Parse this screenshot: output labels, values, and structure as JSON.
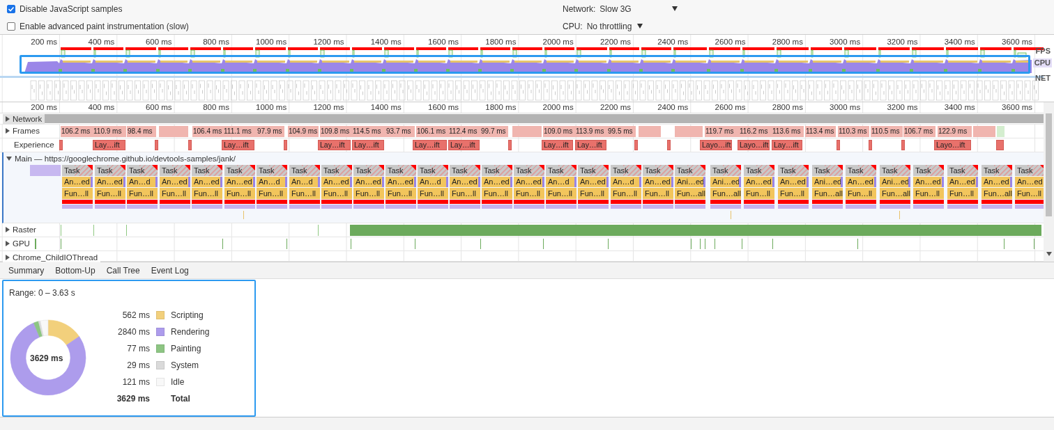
{
  "settings": [
    {
      "label": "Disable JavaScript samples",
      "checked": true
    },
    {
      "label": "Enable advanced paint instrumentation (slow)",
      "checked": false
    }
  ],
  "throttling": [
    {
      "label": "Network:",
      "value": "Slow 3G"
    },
    {
      "label": "CPU:",
      "value": "No throttling"
    }
  ],
  "overview": {
    "ruler": [
      "200 ms",
      "400 ms",
      "600 ms",
      "800 ms",
      "1000 ms",
      "1200 ms",
      "1400 ms",
      "1600 ms",
      "1800 ms",
      "2000 ms",
      "2200 ms",
      "2400 ms",
      "2600 ms",
      "2800 ms",
      "3000 ms",
      "3200 ms",
      "3400 ms",
      "3600 ms"
    ],
    "lanes": [
      "FPS",
      "CPU",
      "NET"
    ]
  },
  "timeline": {
    "ruler": [
      "200 ms",
      "400 ms",
      "600 ms",
      "800 ms",
      "1000 ms",
      "1200 ms",
      "1400 ms",
      "1600 ms",
      "1800 ms",
      "2000 ms",
      "2200 ms",
      "2400 ms",
      "2600 ms",
      "2800 ms",
      "3000 ms",
      "3200 ms",
      "3400 ms",
      "3600 ms"
    ],
    "tracks": [
      {
        "kind": "network",
        "label": "Network",
        "expanded": false
      },
      {
        "kind": "frames",
        "label": "Frames",
        "expanded": false
      },
      {
        "kind": "experience",
        "label": "Experience"
      },
      {
        "kind": "main",
        "label": "Main — https://googlechrome.github.io/devtools-samples/jank/",
        "expanded": true
      },
      {
        "kind": "raster",
        "label": "Raster",
        "expanded": false
      },
      {
        "kind": "gpu",
        "label": "GPU",
        "expanded": false
      },
      {
        "kind": "thread",
        "label": "Chrome_ChildIOThread",
        "expanded": false
      }
    ],
    "frames": [
      "106.2 ms",
      "110.9 ms",
      "98.4 ms",
      "106.4 ms",
      "111.1 ms",
      "97.9 ms",
      "104.9 ms",
      "109.8 ms",
      "114.5 ms",
      "93.7 ms",
      "106.1 ms",
      "112.4 ms",
      "99.7 ms",
      "109.0 ms",
      "113.9 ms",
      "99.5 ms",
      "119.7 ms",
      "116.2 ms",
      "113.6 ms",
      "113.4 ms",
      "110.3 ms",
      "110.5 ms",
      "106.7 ms",
      "122.9 ms"
    ],
    "experience": [
      "Lay…ift",
      "Lay…ift",
      "Lay…ift",
      "Lay…ift",
      "Lay…ift",
      "Lay…ift",
      "Lay…ift",
      "Lay…ift",
      "Layo…ift",
      "Layo…ift",
      "Lay…ift",
      "Layo…ift"
    ],
    "main_tasks": [
      {
        "task": "Task",
        "animation": "An…ed",
        "function": "Fun…ll"
      },
      {
        "task": "Task",
        "animation": "An…ed",
        "function": "Fun…ll"
      },
      {
        "task": "Task",
        "animation": "An…d",
        "function": "Fun…ll"
      },
      {
        "task": "Task",
        "animation": "An…ed",
        "function": "Fun…ll"
      },
      {
        "task": "Task",
        "animation": "An…ed",
        "function": "Fun…ll"
      },
      {
        "task": "Task",
        "animation": "An…ed",
        "function": "Fun…ll"
      },
      {
        "task": "Task",
        "animation": "An…d",
        "function": "Fun…ll"
      },
      {
        "task": "Task",
        "animation": "An…d",
        "function": "Fun…ll"
      },
      {
        "task": "Task",
        "animation": "An…ed",
        "function": "Fun…ll"
      },
      {
        "task": "Task",
        "animation": "An…ed",
        "function": "Fun…ll"
      },
      {
        "task": "Task",
        "animation": "An…ed",
        "function": "Fun…ll"
      },
      {
        "task": "Task",
        "animation": "An…d",
        "function": "Fun…ll"
      },
      {
        "task": "Task",
        "animation": "An…ed",
        "function": "Fun…ll"
      },
      {
        "task": "Task",
        "animation": "An…ed",
        "function": "Fun…ll"
      },
      {
        "task": "Task",
        "animation": "An…ed",
        "function": "Fun…ll"
      },
      {
        "task": "Task",
        "animation": "An…d",
        "function": "Fun…ll"
      },
      {
        "task": "Task",
        "animation": "An…ed",
        "function": "Fun…ll"
      },
      {
        "task": "Task",
        "animation": "An…d",
        "function": "Fun…ll"
      },
      {
        "task": "Task",
        "animation": "An…ed",
        "function": "Fun…ll"
      },
      {
        "task": "Task",
        "animation": "Ani…ed",
        "function": "Fun…all"
      },
      {
        "task": "Task",
        "animation": "Ani…ed",
        "function": "Fun…all"
      },
      {
        "task": "Task",
        "animation": "An…ed",
        "function": "Fun…ll"
      },
      {
        "task": "Task",
        "animation": "An…ed",
        "function": "Fun…ll"
      },
      {
        "task": "Task",
        "animation": "Ani…ed",
        "function": "Fun…all"
      },
      {
        "task": "Task",
        "animation": "An…ed",
        "function": "Fun…ll"
      },
      {
        "task": "Task",
        "animation": "Ani…ed",
        "function": "Fun…all"
      },
      {
        "task": "Task",
        "animation": "An…ed",
        "function": "Fun…ll"
      },
      {
        "task": "Task",
        "animation": "An…ed",
        "function": "Fun…ll"
      },
      {
        "task": "Task",
        "animation": "An…ed",
        "function": "Fun…all"
      },
      {
        "task": "Task",
        "animation": "An…ed",
        "function": "Fun…ll"
      }
    ]
  },
  "details": {
    "tabs": [
      "Summary",
      "Bottom-Up",
      "Call Tree",
      "Event Log"
    ],
    "range": "Range: 0 – 3.63 s",
    "chart_data": {
      "type": "donut",
      "categories": [
        "Scripting",
        "Rendering",
        "Painting",
        "System",
        "Idle"
      ],
      "values": [
        15.49,
        78.26,
        2.12,
        0.8,
        3.33
      ]
    },
    "center_label": "3629 ms",
    "legend": [
      {
        "value": "562 ms",
        "color": "#f2d07c"
      },
      {
        "value": "2840 ms",
        "color": "#ad9cec"
      },
      {
        "value": "77 ms",
        "color": "#8dc583"
      },
      {
        "value": "29 ms",
        "color": "#dadada"
      },
      {
        "value": "121 ms",
        "color": "#f8f8f8"
      }
    ],
    "total": {
      "value": "3629 ms",
      "label": "Total"
    }
  }
}
